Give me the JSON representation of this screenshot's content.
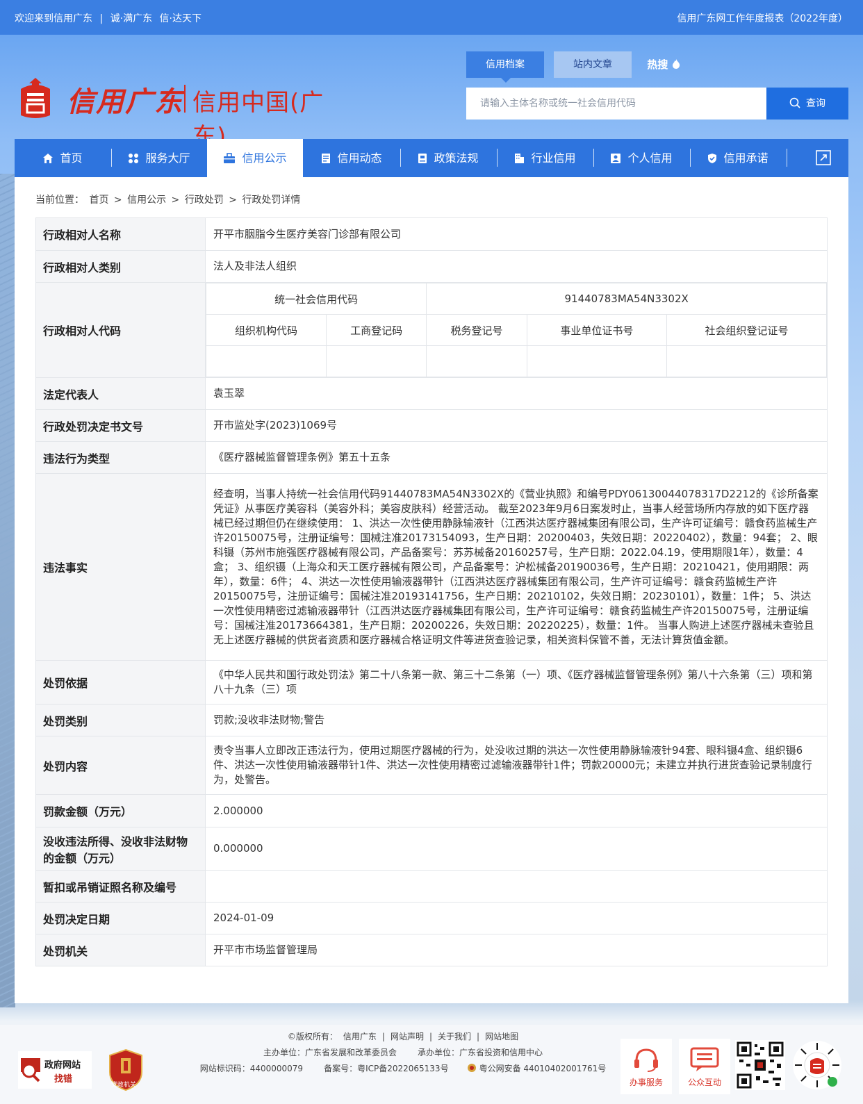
{
  "topbar": {
    "welcome": "欢迎来到信用广东",
    "divider": "|",
    "slogan1": "诚·满广东",
    "slogan2": "信·达天下",
    "right_link": "信用广东网工作年度报表（2022年度）"
  },
  "logo": {
    "script": "信用广东",
    "subtitle": "信用中国(广东)"
  },
  "search": {
    "tabs": [
      "信用档案",
      "站内文章",
      "热搜"
    ],
    "placeholder": "请输入主体名称或统一社会信用代码",
    "button": "查询"
  },
  "nav": {
    "items": [
      "首页",
      "服务大厅",
      "信用公示",
      "信用动态",
      "政策法规",
      "行业信用",
      "个人信用",
      "信用承诺"
    ],
    "active_index": 2
  },
  "breadcrumb": {
    "prefix": "当前位置：",
    "items": [
      "首页",
      "信用公示",
      "行政处罚",
      "行政处罚详情"
    ],
    "sep": ">"
  },
  "record": {
    "name_label": "行政相对人名称",
    "name": "开平市胭脂今生医疗美容门诊部有限公司",
    "category_label": "行政相对人类别",
    "category": "法人及非法人组织",
    "code_label": "行政相对人代码",
    "uscc_label": "统一社会信用代码",
    "uscc": "91440783MA54N3302X",
    "code_headers": [
      "组织机构代码",
      "工商登记码",
      "税务登记号",
      "事业单位证书号",
      "社会组织登记证号"
    ],
    "legal_rep_label": "法定代表人",
    "legal_rep": "袁玉翠",
    "doc_no_label": "行政处罚决定书文号",
    "doc_no": "开市监处字(2023)1069号",
    "violation_type_label": "违法行为类型",
    "violation_type": "《医疗器械监督管理条例》第五十五条",
    "facts_label": "违法事实",
    "facts": "经查明，当事人持统一社会信用代码91440783MA54N3302X的《营业执照》和编号PDY06130044078317D2212的《诊所备案凭证》从事医疗美容科（美容外科；美容皮肤科）经营活动。 截至2023年9月6日案发时止，当事人经营场所内存放的如下医疗器械已经过期但仍在继续使用： 1、洪达一次性使用静脉输液针（江西洪达医疗器械集团有限公司，生产许可证编号：赣食药监械生产许20150075号，注册证编号：国械注准20173154093，生产日期：20200403，失效日期：20220402），数量：94套； 2、眼科镊（苏州市施强医疗器械有限公司，产品备案号：苏苏械备20160257号，生产日期：2022.04.19，使用期限1年），数量：4盒； 3、组织镊（上海众和天工医疗器械有限公司，产品备案号：沪松械备20190036号，生产日期：20210421，使用期限：两年），数量：6件； 4、洪达一次性使用输液器带针（江西洪达医疗器械集团有限公司，生产许可证编号：赣食药监械生产许20150075号，注册证编号：国械注准20193141756，生产日期：20210102，失效日期：20230101），数量：1件； 5、洪达一次性使用精密过滤输液器带针（江西洪达医疗器械集团有限公司，生产许可证编号：赣食药监械生产许20150075号，注册证编号：国械注准20173664381，生产日期：20200226，失效日期：20220225），数量：1件。 当事人购进上述医疗器械未查验且无上述医疗器械的供货者资质和医疗器械合格证明文件等进货查验记录，相关资料保管不善，无法计算货值金额。",
    "basis_label": "处罚依据",
    "basis": "《中华人民共和国行政处罚法》第二十八条第一款、第三十二条第（一）项、《医疗器械监督管理条例》第八十六条第（三）项和第八十九条（三）项",
    "penalty_type_label": "处罚类别",
    "penalty_type": "罚款;没收非法财物;警告",
    "penalty_content_label": "处罚内容",
    "penalty_content": "责令当事人立即改正违法行为，使用过期医疗器械的行为，处没收过期的洪达一次性使用静脉输液针94套、眼科镊4盒、组织镊6件、洪达一次性使用输液器带针1件、洪达一次性使用精密过滤输液器带针1件；罚款20000元；未建立并执行进货查验记录制度行为，处警告。",
    "fine_label": "罚款金额（万元）",
    "fine": "2.000000",
    "confiscation_label": "没收违法所得、没收非法财物的金额（万元）",
    "confiscation": "0.000000",
    "license_label": "暂扣或吊销证照名称及编号",
    "license": "",
    "date_label": "处罚决定日期",
    "date": "2024-01-09",
    "authority_label": "处罚机关",
    "authority": "开平市市场监督管理局"
  },
  "footer": {
    "gov_logo_t1": "政府网站",
    "gov_logo_t2": "找错",
    "party_logo": "党政机关",
    "line1": [
      "©版权所有：",
      "信用广东",
      "|",
      "网站声明",
      "|",
      "关于我们",
      "|",
      "网站地图"
    ],
    "line2": [
      "主办单位：广东省发展和改革委员会",
      "承办单位：广东省投资和信用中心"
    ],
    "line3": [
      "网站标识码：4400000079",
      "备案号：粤ICP备2022065133号",
      "粤公网安备 44010402001761号"
    ],
    "service_label": "办事服务",
    "interaction_label": "公众互动"
  },
  "colors": {
    "brand_blue": "#2e74de",
    "logo_red": "#d62a1e"
  }
}
